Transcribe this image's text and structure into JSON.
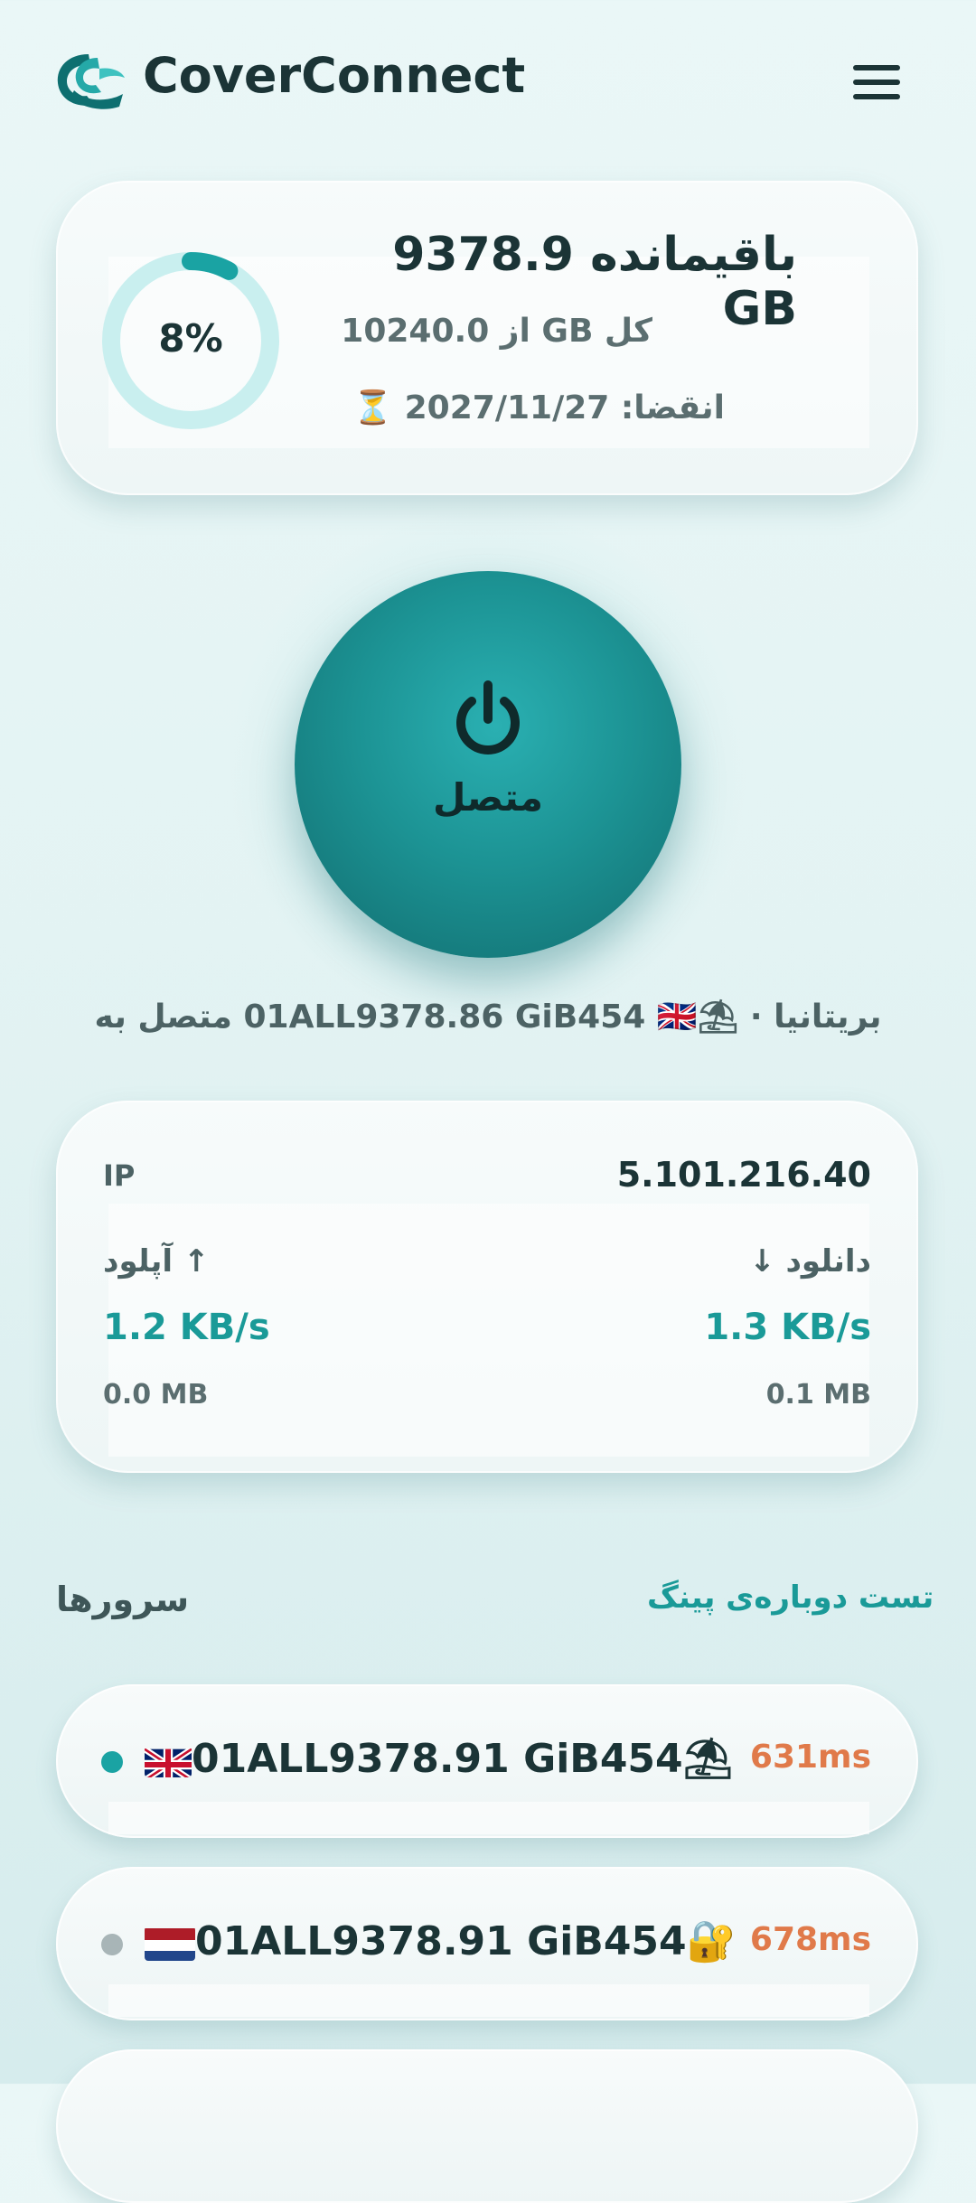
{
  "app": {
    "title": "CoverConnect"
  },
  "usage": {
    "percent_label": "8%",
    "percent_value": 8,
    "remaining": "باقیمانده 9378.9 GB",
    "total": "کل GB از 10240.0",
    "expiry": "انقضا: 2027/11/27 ⏳"
  },
  "power": {
    "status_label": "متصل"
  },
  "connection": {
    "line": "بریتانیا · ⛱01ALL9378.86 GiB454 🇬🇧 متصل به"
  },
  "stats": {
    "ip_label": "IP",
    "ip_value": "5.101.216.40",
    "upload_label": "↑ آپلود",
    "download_label": "دانلود ↓",
    "upload_speed": "1.2 KB/s",
    "download_speed": "1.3 KB/s",
    "upload_total": "0.0 MB",
    "download_total": "0.1 MB"
  },
  "servers": {
    "title": "سرورها",
    "retest_label": "تست دوباره‌ی پینگ",
    "items": [
      {
        "name": "01ALL9378.91 GiB454⛱",
        "ping": "631ms",
        "flag": "uk",
        "active": true
      },
      {
        "name": "01ALL9378.91 GiB454🔐",
        "ping": "678ms",
        "flag": "nl",
        "active": false
      }
    ]
  },
  "colors": {
    "accent": "#1a9a98",
    "ping": "#e07a4a",
    "active_dot": "#1aa3a3",
    "inactive_dot": "#a8b5b7"
  }
}
